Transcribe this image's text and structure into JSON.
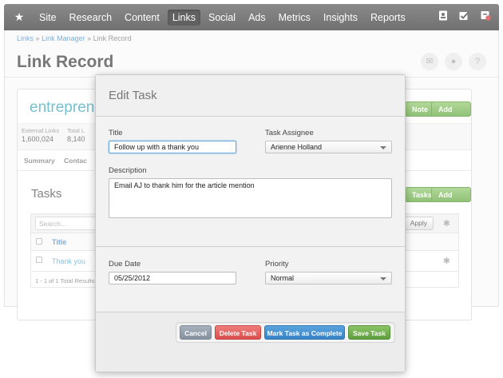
{
  "nav": {
    "star": "★",
    "items": [
      "Site",
      "Research",
      "Content",
      "Links",
      "Social",
      "Ads",
      "Metrics",
      "Insights",
      "Reports"
    ],
    "active": "Links",
    "icons": [
      "contacts-icon",
      "tasks-icon",
      "alerts-icon"
    ]
  },
  "breadcrumb": {
    "items": [
      "Links",
      "Link Manager",
      "Link Record"
    ],
    "separator": "»"
  },
  "page": {
    "title": "Link Record",
    "header_icons": [
      "mail-icon",
      "comment-icon",
      "help-icon"
    ]
  },
  "record": {
    "name": "entreprene",
    "note_button": "Note",
    "add_task_button": "Add Task",
    "stats": [
      {
        "label": "External Links",
        "value": "1,600,024"
      },
      {
        "label": "Total L",
        "value": "8,140"
      }
    ],
    "tabs": [
      "Summary",
      "Contac"
    ]
  },
  "tasks": {
    "title": "Tasks",
    "tasks_button": "Tasks",
    "add_task_button": "Add Task",
    "search_placeholder": "Search...",
    "apply": "Apply",
    "column_title": "Title",
    "rows": [
      {
        "title": "Thank you"
      }
    ],
    "footer": "1 - 1 of 1 Total Results"
  },
  "modal": {
    "title": "Edit Task",
    "title_label": "Title",
    "title_value": "Follow up with a thank you",
    "assignee_label": "Task Assignee",
    "assignee_value": "Arienne Holland",
    "description_label": "Description",
    "description_value": "Email AJ to thank him for the article mention",
    "due_label": "Due Date",
    "due_value": "05/25/2012",
    "priority_label": "Priority",
    "priority_value": "Normal",
    "buttons": {
      "cancel": "Cancel",
      "delete": "Delete Task",
      "complete": "Mark Task as Complete",
      "save": "Save Task"
    }
  },
  "colors": {
    "nav_bg": "#5a5a5a",
    "brand": "#54b1c4",
    "green": "#76b357",
    "red": "#d94e4c",
    "blue": "#3683c7",
    "gray": "#8691a0"
  }
}
